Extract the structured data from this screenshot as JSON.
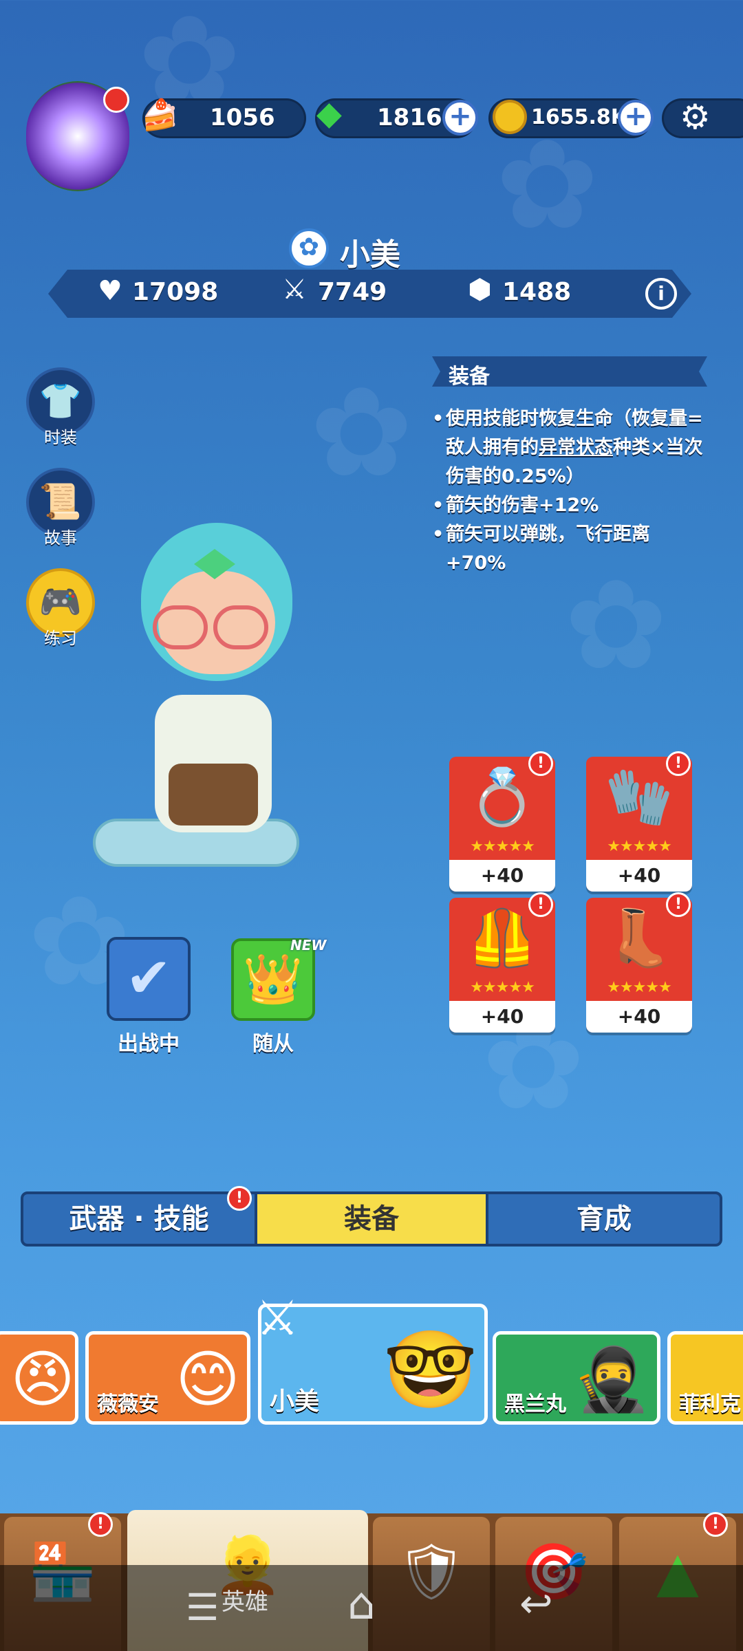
{
  "resources": {
    "cake": "1056",
    "gems": "1816",
    "coins": "1655.8K"
  },
  "hero": {
    "name": "小美",
    "hp": "17098",
    "attack": "7749",
    "defense": "1488"
  },
  "side_menu": {
    "fashion": "时装",
    "story": "故事",
    "practice": "练习"
  },
  "equipment": {
    "title": "装备",
    "desc": [
      {
        "pre": "使用技能时恢复生命（恢复量=敌人拥有的",
        "link": "异常状态",
        "post": "种类×当次伤害的0.25%）"
      },
      {
        "pre": "箭矢的伤害+12%",
        "link": "",
        "post": ""
      },
      {
        "pre": "箭矢可以弹跳，飞行距离+70%",
        "link": "",
        "post": ""
      }
    ],
    "cards": [
      {
        "level": "+40",
        "stars": "★★★★★",
        "icon": "winged-ring-icon"
      },
      {
        "level": "+40",
        "stars": "★★★★★",
        "icon": "gauntlet-icon"
      },
      {
        "level": "+40",
        "stars": "★★★★★",
        "icon": "armor-icon"
      },
      {
        "level": "+40",
        "stars": "★★★★★",
        "icon": "boot-icon"
      }
    ]
  },
  "actions": {
    "deployed": "出战中",
    "follower": "随从",
    "new_tag": "NEW"
  },
  "tabs": [
    "武器 · 技能",
    "装备",
    "育成"
  ],
  "heroes": [
    "薇薇安",
    "小美",
    "黑兰丸",
    "菲利克"
  ],
  "nav": {
    "hero_label": "英雄",
    "badge": "!"
  },
  "colors": {
    "active_tab": "#f7dd4a",
    "badge": "#e8312a"
  }
}
